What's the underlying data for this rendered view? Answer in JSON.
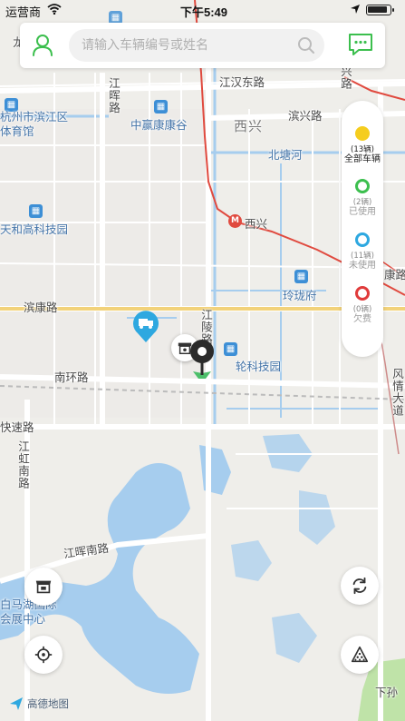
{
  "status_bar": {
    "carrier": "运营商",
    "time": "下午5:49",
    "battery_level": 0.9
  },
  "search": {
    "placeholder": "请输入车辆编号或姓名",
    "value": ""
  },
  "icons": {
    "user": "user-icon",
    "search": "search-icon",
    "message": "message-icon",
    "refresh": "refresh-icon",
    "locate": "locate-icon",
    "station": "station-icon",
    "layers": "layers-icon"
  },
  "filters": [
    {
      "count": "(13辆)",
      "label": "全部车辆",
      "color": "#f5cd1e",
      "style": "filled"
    },
    {
      "count": "(2辆)",
      "label": "已使用",
      "color": "#3cbf4e",
      "style": "ring"
    },
    {
      "count": "(11辆)",
      "label": "未使用",
      "color": "#2ea8e0",
      "style": "ring"
    },
    {
      "count": "(0辆)",
      "label": "欠费",
      "color": "#e03b3b",
      "style": "ring"
    }
  ],
  "colors": {
    "accent_green": "#3cbf4e",
    "map_bg": "#efeeea",
    "metro_red": "#e04a3f",
    "road_yellow": "#f2d27a",
    "water": "#a6cdee"
  },
  "map_labels": {
    "jianghan_east_road": "江汉东路",
    "binxing_road": "滨兴路",
    "xixing_area": "西兴",
    "beitang_river": "北塘河",
    "xixing_station": "西兴",
    "linglong_fu": "玲珑府",
    "binkang_road": "滨康路",
    "nanhuan_road": "南环路",
    "jiangling_road": "江陵路",
    "kuaisu_road": "快速路",
    "jianghong_road": "江虹南路",
    "jianghui_south_road": "江晖南路",
    "jianghui_road": "江晖路",
    "zhongying_kanggu": "中赢康康谷",
    "binjiang_gym": "杭州市滨江区体育馆",
    "tianhe_park": "天和高科技园",
    "lun_tech_park": "轮科技园",
    "xing_road_right": "兴路",
    "kang_road_right": "康路",
    "fengqing_road": "风情大道",
    "baimahu": "白马湖国际会展中心",
    "xiasun": "下孙",
    "long_top": "龙",
    "long_top2": "滨",
    "map_logo": "高德地图"
  }
}
